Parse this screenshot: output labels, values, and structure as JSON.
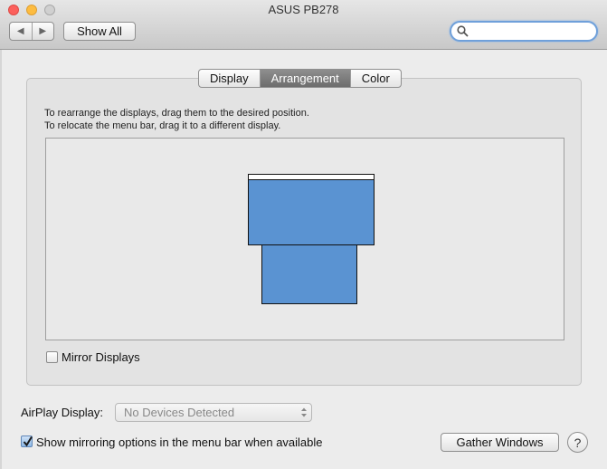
{
  "window": {
    "title": "ASUS PB278"
  },
  "toolbar": {
    "back_icon": "◀",
    "forward_icon": "▶",
    "show_all_label": "Show All",
    "search_placeholder": ""
  },
  "tabs": [
    {
      "label": "Display",
      "active": false
    },
    {
      "label": "Arrangement",
      "active": true
    },
    {
      "label": "Color",
      "active": false
    }
  ],
  "instructions": {
    "line1": "To rearrange the displays, drag them to the desired position.",
    "line2": "To relocate the menu bar, drag it to a different display."
  },
  "arrangement": {
    "display_color": "#5a93d2",
    "menubar_on": "primary-display"
  },
  "mirror_displays": {
    "label": "Mirror Displays",
    "checked": false
  },
  "airplay": {
    "label": "AirPlay Display:",
    "value": "No Devices Detected"
  },
  "show_mirroring": {
    "label": "Show mirroring options in the menu bar when available",
    "checked": true
  },
  "gather_windows_label": "Gather Windows",
  "help_label": "?"
}
